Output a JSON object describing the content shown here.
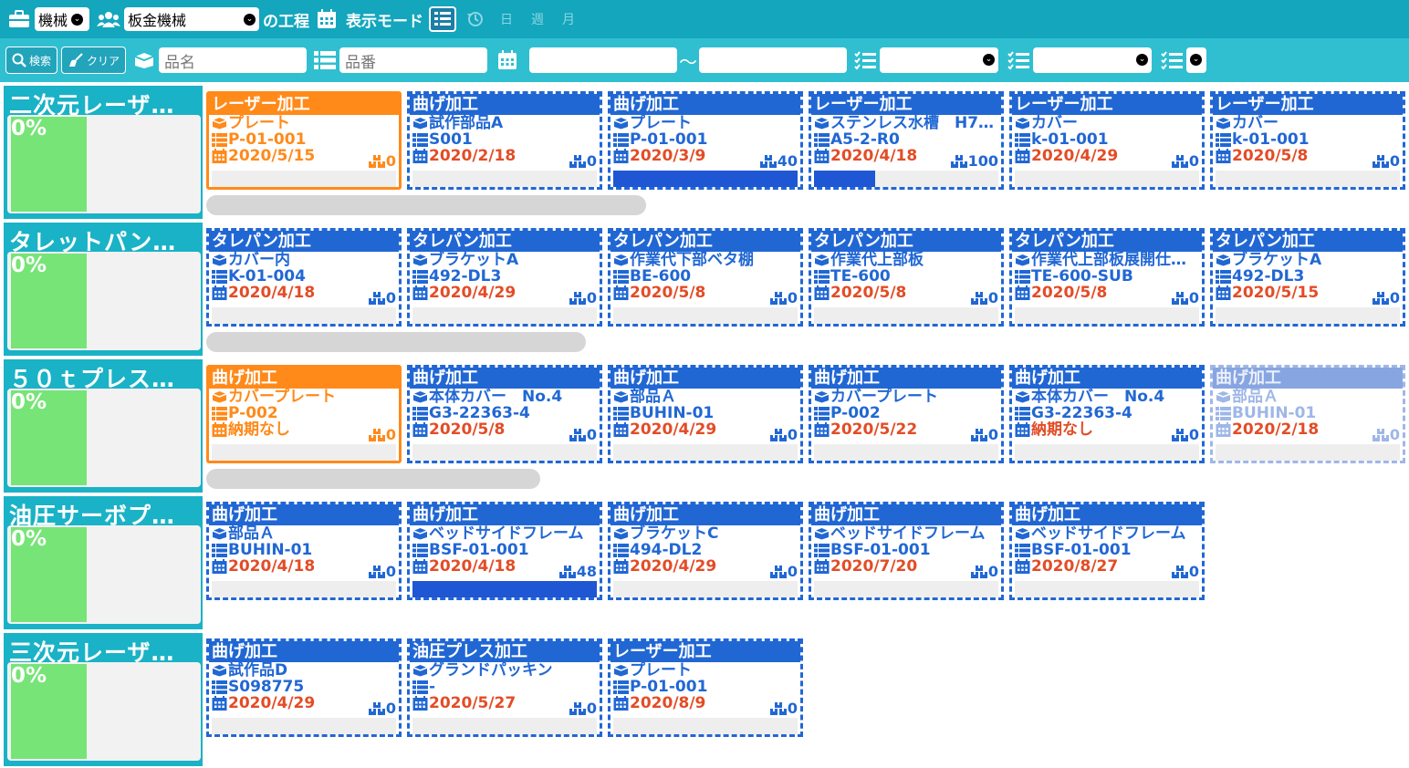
{
  "top": {
    "category_select": "機械",
    "team_select": "板金機械",
    "process_label": "の工程",
    "view_mode_label": "表示モード",
    "day_label": "日",
    "week_label": "週",
    "month_label": "月"
  },
  "filter": {
    "search_label": "検索",
    "clear_label": "クリア",
    "item_name_placeholder": "品名",
    "item_no_placeholder": "品番",
    "range_sep": "～"
  },
  "rows": [
    {
      "title": "二次元レーザ…",
      "percent": "0%",
      "cards": [
        {
          "process": "レーザー加工",
          "name": "プレート",
          "code": "P-01-001",
          "date": "2020/5/15",
          "qty": "0",
          "style": "orange",
          "progress": 0
        },
        {
          "process": "曲げ加工",
          "name": "試作部品A",
          "code": "S001",
          "date": "2020/2/18",
          "qty": "0",
          "style": "normal",
          "progress": 0
        },
        {
          "process": "曲げ加工",
          "name": "プレート",
          "code": "P-01-001",
          "date": "2020/3/9",
          "qty": "40",
          "style": "normal",
          "progress": 1.0
        },
        {
          "process": "レーザー加工",
          "name": "ステンレス水槽　H7…",
          "code": "A5-2-R0",
          "date": "2020/4/18",
          "qty": "100",
          "style": "normal",
          "progress": 0.33
        },
        {
          "process": "レーザー加工",
          "name": "カバー",
          "code": "k-01-001",
          "date": "2020/4/29",
          "qty": "0",
          "style": "normal",
          "progress": 0
        },
        {
          "process": "レーザー加工",
          "name": "カバー",
          "code": "k-01-001",
          "date": "2020/5/8",
          "qty": "0",
          "style": "normal",
          "progress": 0
        }
      ]
    },
    {
      "title": "タレットパン…",
      "percent": "0%",
      "cards": [
        {
          "process": "タレパン加工",
          "name": "カバー内",
          "code": "K-01-004",
          "date": "2020/4/18",
          "qty": "0",
          "style": "normal",
          "progress": 0
        },
        {
          "process": "タレパン加工",
          "name": "ブラケットA",
          "code": "492-DL3",
          "date": "2020/4/29",
          "qty": "0",
          "style": "normal",
          "progress": 0
        },
        {
          "process": "タレパン加工",
          "name": "作業代下部ベタ棚",
          "code": "BE-600",
          "date": "2020/5/8",
          "qty": "0",
          "style": "normal",
          "progress": 0
        },
        {
          "process": "タレパン加工",
          "name": "作業代上部板",
          "code": "TE-600",
          "date": "2020/5/8",
          "qty": "0",
          "style": "normal",
          "progress": 0
        },
        {
          "process": "タレパン加工",
          "name": "作業代上部板展開仕…",
          "code": "TE-600-SUB",
          "date": "2020/5/8",
          "qty": "0",
          "style": "normal",
          "progress": 0
        },
        {
          "process": "タレパン加工",
          "name": "ブラケットA",
          "code": "492-DL3",
          "date": "2020/5/15",
          "qty": "0",
          "style": "normal",
          "progress": 0
        }
      ]
    },
    {
      "title": "５０ｔプレス…",
      "percent": "0%",
      "cards": [
        {
          "process": "曲げ加工",
          "name": "カバープレート",
          "code": "P-002",
          "date": "納期なし",
          "qty": "0",
          "style": "orange",
          "progress": 0
        },
        {
          "process": "曲げ加工",
          "name": "本体カバー　No.4",
          "code": "G3-22363-4",
          "date": "2020/5/8",
          "qty": "0",
          "style": "normal",
          "progress": 0
        },
        {
          "process": "曲げ加工",
          "name": "部品Ａ",
          "code": "BUHIN-01",
          "date": "2020/4/29",
          "qty": "0",
          "style": "normal",
          "progress": 0
        },
        {
          "process": "曲げ加工",
          "name": "カバープレート",
          "code": "P-002",
          "date": "2020/5/22",
          "qty": "0",
          "style": "normal",
          "progress": 0
        },
        {
          "process": "曲げ加工",
          "name": "本体カバー　No.4",
          "code": "G3-22363-4",
          "date": "納期なし",
          "qty": "0",
          "style": "normal",
          "progress": 0
        },
        {
          "process": "曲げ加工",
          "name": "部品Ａ",
          "code": "BUHIN-01",
          "date": "2020/2/18",
          "qty": "0",
          "style": "faded",
          "progress": 0
        }
      ]
    },
    {
      "title": "油圧サーボプ…",
      "percent": "0%",
      "cards": [
        {
          "process": "曲げ加工",
          "name": "部品Ａ",
          "code": "BUHIN-01",
          "date": "2020/4/18",
          "qty": "0",
          "style": "normal",
          "progress": 0
        },
        {
          "process": "曲げ加工",
          "name": "ベッドサイドフレーム",
          "code": "BSF-01-001",
          "date": "2020/4/18",
          "qty": "48",
          "style": "normal",
          "progress": 1.0
        },
        {
          "process": "曲げ加工",
          "name": "ブラケットC",
          "code": "494-DL2",
          "date": "2020/4/29",
          "qty": "0",
          "style": "normal",
          "progress": 0
        },
        {
          "process": "曲げ加工",
          "name": "ベッドサイドフレーム",
          "code": "BSF-01-001",
          "date": "2020/7/20",
          "qty": "0",
          "style": "normal",
          "progress": 0
        },
        {
          "process": "曲げ加工",
          "name": "ベッドサイドフレーム",
          "code": "BSF-01-001",
          "date": "2020/8/27",
          "qty": "0",
          "style": "normal",
          "progress": 0
        }
      ]
    },
    {
      "title": "三次元レーザ…",
      "percent": "0%",
      "cards": [
        {
          "process": "曲げ加工",
          "name": "試作品D",
          "code": "S098775",
          "date": "2020/4/29",
          "qty": "0",
          "style": "normal",
          "progress": 0
        },
        {
          "process": "油圧プレス加工",
          "name": "グランドパッキン",
          "code": "-",
          "date": "2020/5/27",
          "qty": "0",
          "style": "normal",
          "progress": 0
        },
        {
          "process": "レーザー加工",
          "name": "プレート",
          "code": "P-01-001",
          "date": "2020/8/9",
          "qty": "0",
          "style": "normal",
          "progress": 0
        }
      ]
    }
  ]
}
